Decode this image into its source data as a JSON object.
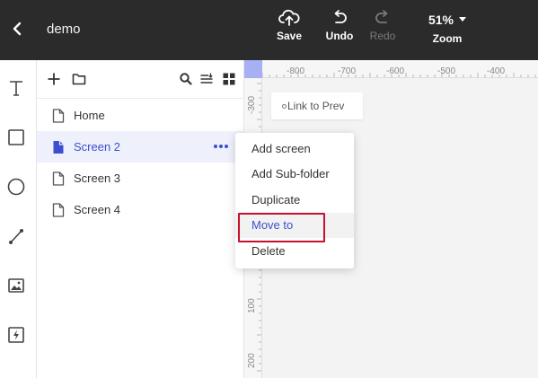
{
  "header": {
    "project_name": "demo",
    "save_label": "Save",
    "undo_label": "Undo",
    "redo_label": "Redo",
    "zoom_value": "51%",
    "zoom_label": "Zoom"
  },
  "tool_rail": {
    "icons": [
      "text-icon",
      "rectangle-icon",
      "circle-icon",
      "line-icon",
      "image-icon",
      "lightning-icon"
    ]
  },
  "panel": {
    "header_icons": [
      "add-icon",
      "folder-icon",
      "search-icon",
      "sort-icon",
      "grid-view-icon"
    ],
    "screens": [
      {
        "label": "Home",
        "active": false
      },
      {
        "label": "Screen 2",
        "active": true
      },
      {
        "label": "Screen 3",
        "active": false
      },
      {
        "label": "Screen 4",
        "active": false
      }
    ]
  },
  "canvas": {
    "ruler_top_labels": [
      "-800",
      "-700",
      "-600",
      "-500",
      "-400"
    ],
    "ruler_left_labels": [
      "-300",
      "100",
      "200"
    ],
    "link_chip_label": "Link to Prev"
  },
  "context_menu": {
    "items": [
      "Add screen",
      "Add Sub-folder",
      "Duplicate",
      "Move to",
      "Delete"
    ],
    "highlighted": "Move to"
  },
  "colors": {
    "topbar": "#2b2b2b",
    "accent": "#3d4fd1",
    "highlight_box": "#c8102e",
    "active_row": "#eef0fb"
  }
}
